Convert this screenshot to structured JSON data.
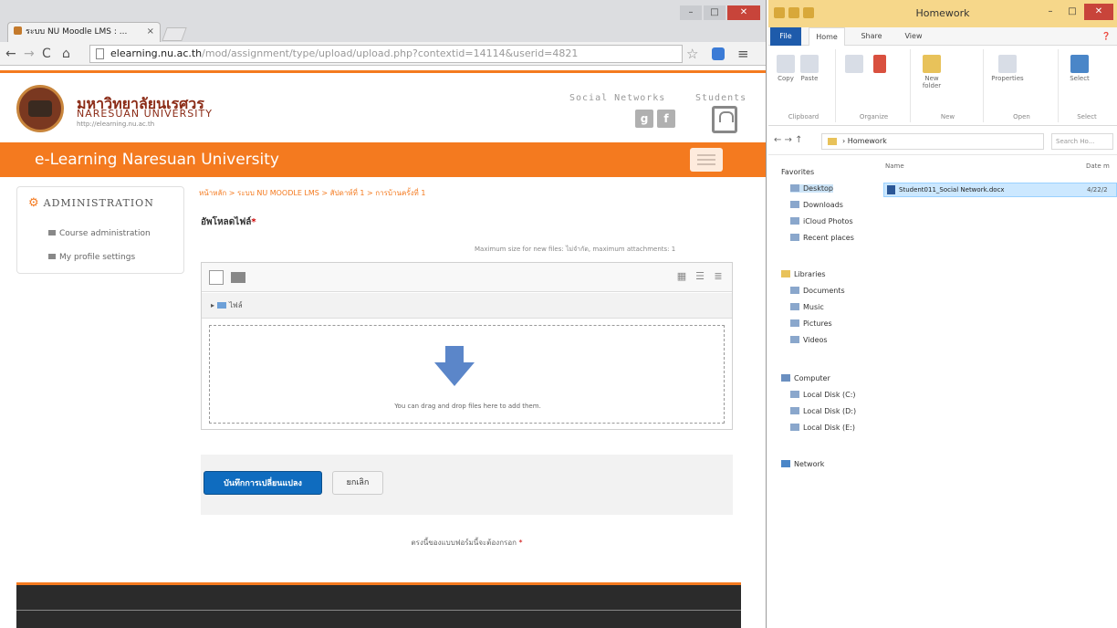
{
  "browser": {
    "tab_title": "ระบบ NU Moodle LMS : ...",
    "url_host": "elearning.nu.ac.th",
    "url_path": "/mod/assignment/type/upload/upload.php?contextid=14114&userid=4821"
  },
  "site": {
    "thai_name": "มหาวิทยาลัยนเรศวร",
    "eng_name": "NARESUAN UNIVERSITY",
    "url_small": "http://elearning.nu.ac.th",
    "social_label": "Social Networks",
    "student_label": "Students",
    "banner": "e-Learning Naresuan University"
  },
  "admin": {
    "title": "ADMINISTRATION",
    "items": [
      "Course administration",
      "My profile settings"
    ]
  },
  "breadcrumb": "หน้าหลัก > ระบบ NU MOODLE LMS > สัปดาห์ที่ 1 > การบ้านครั้งที่ 1",
  "filepicker": {
    "label": "อัพโหลดไฟล์",
    "max_size": "Maximum size for new files: ไม่จำกัด, maximum attachments: 1",
    "folder": "ไฟล์",
    "drop_text": "You can drag and drop files here to add them."
  },
  "buttons": {
    "save": "บันทึกการเปลี่ยนแปลง",
    "cancel": "ยกเลิก"
  },
  "required_note": "ตรงนี้ของแบบฟอร์มนี้จะต้องกรอก",
  "explorer": {
    "title": "Homework",
    "tabs": [
      "File",
      "Home",
      "Share",
      "View"
    ],
    "address": "Homework",
    "search": "Search Ho...",
    "col_name": "Name",
    "col_date": "Date m",
    "file_name": "Student011_Social Network.docx",
    "file_date": "4/22/2",
    "nav": {
      "favorites": "Favorites",
      "fav_items": [
        "Desktop",
        "Downloads",
        "iCloud Photos",
        "Recent places"
      ],
      "libraries": "Libraries",
      "lib_items": [
        "Documents",
        "Music",
        "Pictures",
        "Videos"
      ],
      "computer": "Computer",
      "comp_items": [
        "Local Disk (C:)",
        "Local Disk (D:)",
        "Local Disk (E:)"
      ],
      "network": "Network"
    },
    "ribbon_groups": [
      "Clipboard",
      "Organize",
      "New",
      "Open",
      "Select"
    ]
  }
}
